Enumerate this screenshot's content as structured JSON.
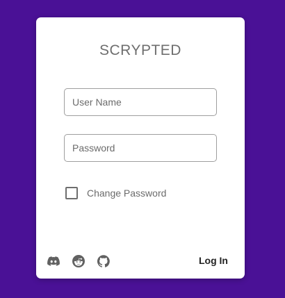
{
  "app": {
    "title": "SCRYPTED"
  },
  "form": {
    "username": {
      "placeholder": "User Name",
      "value": ""
    },
    "password": {
      "placeholder": "Password",
      "value": ""
    },
    "change_password": {
      "label": "Change Password",
      "checked": false
    }
  },
  "footer": {
    "social": [
      {
        "icon": "discord-icon"
      },
      {
        "icon": "reddit-icon"
      },
      {
        "icon": "github-icon"
      }
    ],
    "login_label": "Log In"
  },
  "colors": {
    "background": "#4a1196",
    "card": "#ffffff",
    "icon": "#616161"
  }
}
